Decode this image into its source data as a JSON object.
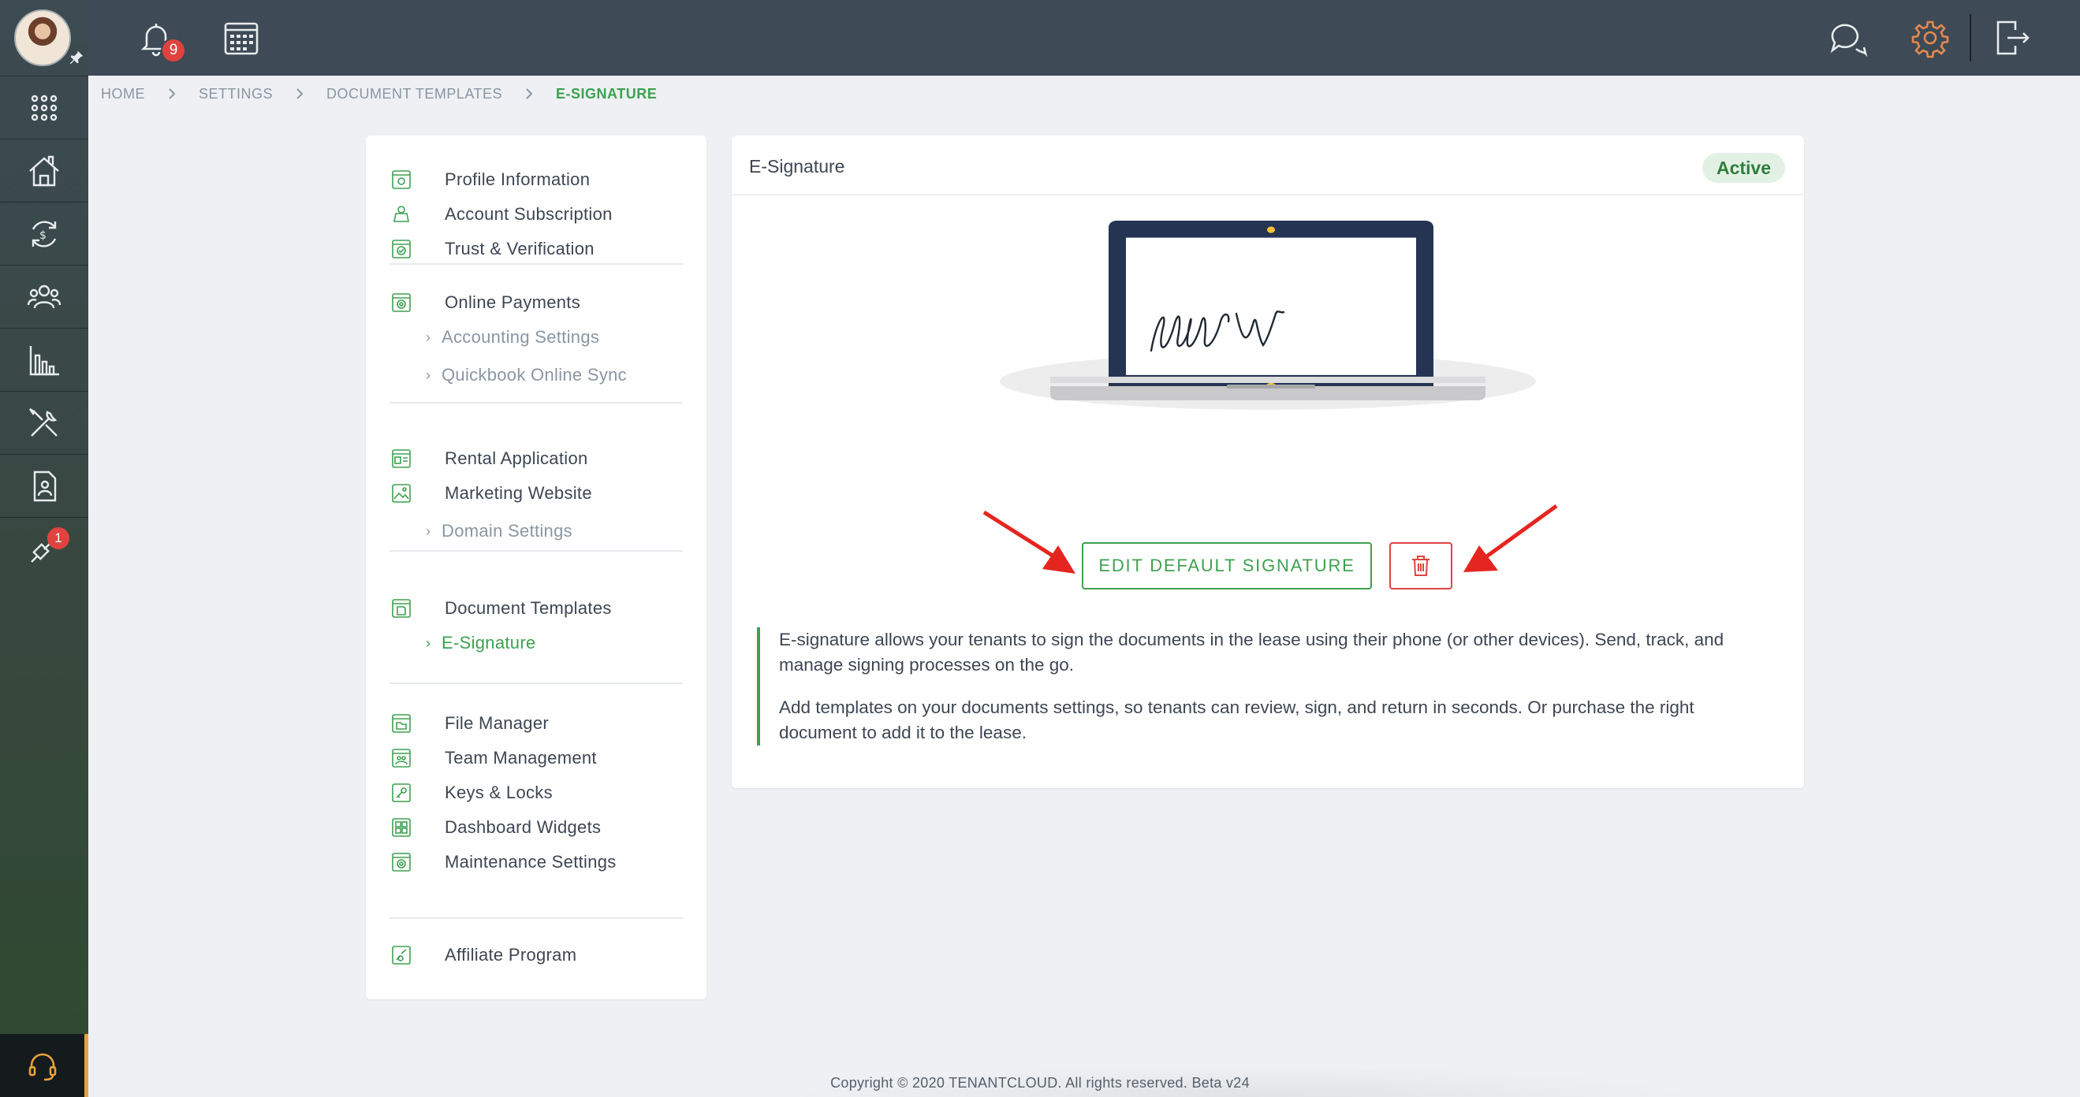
{
  "topbar": {
    "notifications_count": "9"
  },
  "rail": {
    "tools_badge": "1"
  },
  "breadcrumb": [
    "HOME",
    "SETTINGS",
    "DOCUMENT TEMPLATES",
    "E-SIGNATURE"
  ],
  "menu": {
    "groups": [
      {
        "items": [
          {
            "label": "Profile Information",
            "icon": "profile-icon"
          },
          {
            "label": "Account Subscription",
            "icon": "subscription-icon"
          },
          {
            "label": "Trust & Verification",
            "icon": "verification-icon"
          }
        ]
      },
      {
        "items": [
          {
            "label": "Online Payments",
            "icon": "payments-icon"
          }
        ],
        "subs": [
          "Accounting Settings",
          "Quickbook Online Sync"
        ]
      },
      {
        "items": [
          {
            "label": "Rental Application",
            "icon": "application-icon"
          },
          {
            "label": "Marketing Website",
            "icon": "website-icon"
          }
        ],
        "subs": [
          "Domain Settings"
        ]
      },
      {
        "items": [
          {
            "label": "Document Templates",
            "icon": "document-icon"
          }
        ],
        "subs": [
          "E-Signature"
        ]
      },
      {
        "items": [
          {
            "label": "File Manager",
            "icon": "file-icon"
          },
          {
            "label": "Team Management",
            "icon": "team-icon"
          },
          {
            "label": "Keys & Locks",
            "icon": "key-icon"
          },
          {
            "label": "Dashboard Widgets",
            "icon": "widgets-icon"
          },
          {
            "label": "Maintenance Settings",
            "icon": "maintenance-icon"
          }
        ]
      },
      {
        "items": [
          {
            "label": "Affiliate Program",
            "icon": "affiliate-icon"
          }
        ]
      }
    ]
  },
  "panel": {
    "title": "E-Signature",
    "status": "Active",
    "edit_button": "EDIT DEFAULT SIGNATURE",
    "description": [
      "E-signature allows your tenants to sign the documents in the lease using their phone (or other devices). Send, track, and manage signing processes on the go.",
      "Add templates on your documents settings, so tenants can review, sign, and return in seconds. Or purchase the right document to add it to the lease."
    ]
  },
  "colors": {
    "accent": "#3ea151",
    "danger": "#e0433f",
    "topbar": "#3e4a55"
  },
  "footer": "Copyright © 2020 TENANTCLOUD. All rights reserved. Beta v24"
}
